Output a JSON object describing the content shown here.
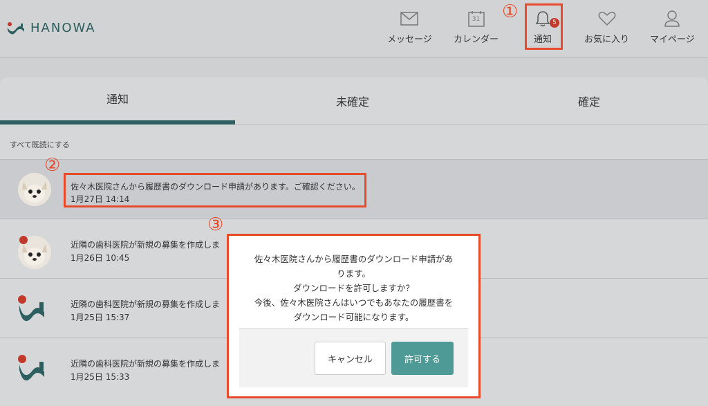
{
  "header": {
    "logo_text": "HANOWA",
    "nav": [
      {
        "label": "メッセージ"
      },
      {
        "label": "カレンダー",
        "calendar_day": "31"
      },
      {
        "label": "通知",
        "badge": "5"
      },
      {
        "label": "お気に入り"
      },
      {
        "label": "マイページ"
      }
    ]
  },
  "callouts": [
    "①",
    "②",
    "③"
  ],
  "tabs": [
    {
      "label": "通知"
    },
    {
      "label": "未確定"
    },
    {
      "label": "確定"
    }
  ],
  "mark_all_read": "すべて既読にする",
  "notifications": [
    {
      "message": "佐々木医院さんから履歴書のダウンロード申請があります。ご確認ください。",
      "date": "1月27日 14:14",
      "avatar": "dog-avatar",
      "unread": false
    },
    {
      "message": "近隣の歯科医院が新規の募集を作成しま",
      "date": "1月26日 10:45",
      "avatar": "dog-avatar",
      "unread": true
    },
    {
      "message": "近隣の歯科医院が新規の募集を作成しま",
      "date": "1月25日 15:37",
      "avatar": "hanowa-logo",
      "unread": true
    },
    {
      "message": "近隣の歯科医院が新規の募集を作成しま",
      "date": "1月25日 15:33",
      "avatar": "hanowa-logo",
      "unread": true
    }
  ],
  "modal": {
    "lines": [
      "佐々木医院さんから履歴書のダウンロード申請があ",
      "ります。",
      "ダウンロードを許可しますか？",
      "今後、佐々木医院さんはいつでもあなたの履歴書を",
      "ダウンロード可能になります。"
    ],
    "cancel_label": "キャンセル",
    "ok_label": "許可する"
  },
  "colors": {
    "brand": "#2d5f60",
    "accent_button": "#4e9a96",
    "callout": "#e84a2c",
    "badge": "#c0392b"
  }
}
